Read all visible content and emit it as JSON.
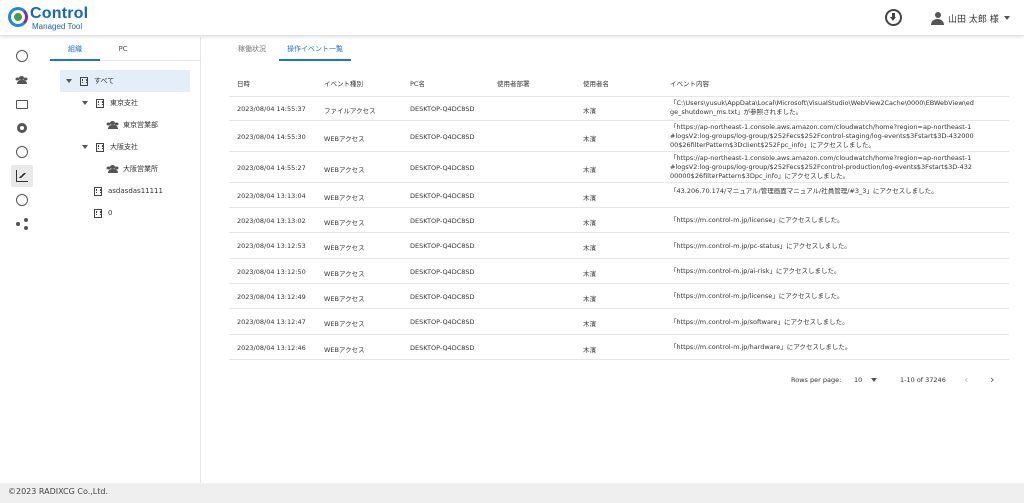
{
  "header": {
    "logo_title": "Control",
    "logo_subtitle": "Managed Tool",
    "user_name": "山田 太郎 様"
  },
  "rail": {
    "icons": [
      "gauge-icon",
      "users-icon",
      "monitor-icon",
      "target-icon",
      "badge-icon",
      "chart-icon",
      "download-circle-icon",
      "share-icon"
    ],
    "active": "chart-icon"
  },
  "org_panel": {
    "tabs": [
      "組織",
      "PC"
    ],
    "active_tab": "組織",
    "tree": [
      {
        "label": "すべて",
        "type": "building",
        "expanded": true,
        "selected": true
      },
      {
        "label": "東京支社",
        "type": "building",
        "expanded": true
      },
      {
        "label": "東京営業部",
        "type": "group"
      },
      {
        "label": "大阪支社",
        "type": "building",
        "expanded": true
      },
      {
        "label": "大阪営業所",
        "type": "group"
      },
      {
        "label": "asdasdas11111",
        "type": "building"
      },
      {
        "label": "0",
        "type": "building"
      }
    ]
  },
  "main": {
    "tabs": [
      "稼働状況",
      "操作イベント一覧"
    ],
    "active_tab": "操作イベント一覧",
    "columns": [
      "日時",
      "イベント種別",
      "PC名",
      "使用者部署",
      "使用者名",
      "イベント内容"
    ],
    "rows": [
      {
        "datetime": "2023/08/04 14:55:37",
        "type": "ファイルアクセス",
        "pc": "DESKTOP-Q4DC8SD",
        "dept": "",
        "user": "木濱",
        "content": "「C:\\Users\\yusuk\\AppData\\Local\\Microsoft\\VisualStudio\\WebView2Cache\\0000\\EBWebView\\edge_shutdown_ms.txt」が参照されました。"
      },
      {
        "datetime": "2023/08/04 14:55:30",
        "type": "WEBアクセス",
        "pc": "DESKTOP-Q4DC8SD",
        "dept": "",
        "user": "木濱",
        "content": "「https://ap-northeast-1.console.aws.amazon.com/cloudwatch/home?region=ap-northeast-1#logsV2:log-groups/log-group/$252Fecs$252Fcontrol-staging/log-events$3Fstart$3D-43200000$26filterPattern$3Dclient$252Fpc_info」にアクセスしました。"
      },
      {
        "datetime": "2023/08/04 14:55:27",
        "type": "WEBアクセス",
        "pc": "DESKTOP-Q4DC8SD",
        "dept": "",
        "user": "木濱",
        "content": "「https://ap-northeast-1.console.aws.amazon.com/cloudwatch/home?region=ap-northeast-1#logsV2:log-groups/log-group/$252Fecs$252Fcontrol-production/log-events$3Fstart$3D-43200000$26filterPattern$3Dpc_info」にアクセスしました。"
      },
      {
        "datetime": "2023/08/04 13:13:04",
        "type": "WEBアクセス",
        "pc": "DESKTOP-Q4DC8SD",
        "dept": "",
        "user": "木濱",
        "content": "「43.206.70.174/マニュアル/管理画面マニュアル/社員管理/#3_3」にアクセスしました。"
      },
      {
        "datetime": "2023/08/04 13:13:02",
        "type": "WEBアクセス",
        "pc": "DESKTOP-Q4DC8SD",
        "dept": "",
        "user": "木濱",
        "content": "「https://m.control-m.jp/license」にアクセスしました。"
      },
      {
        "datetime": "2023/08/04 13:12:53",
        "type": "WEBアクセス",
        "pc": "DESKTOP-Q4DC8SD",
        "dept": "",
        "user": "木濱",
        "content": "「https://m.control-m.jp/pc-status」にアクセスしました。"
      },
      {
        "datetime": "2023/08/04 13:12:50",
        "type": "WEBアクセス",
        "pc": "DESKTOP-Q4DC8SD",
        "dept": "",
        "user": "木濱",
        "content": "「https://m.control-m.jp/ai-risk」にアクセスしました。"
      },
      {
        "datetime": "2023/08/04 13:12:49",
        "type": "WEBアクセス",
        "pc": "DESKTOP-Q4DC8SD",
        "dept": "",
        "user": "木濱",
        "content": "「https://m.control-m.jp/license」にアクセスしました。"
      },
      {
        "datetime": "2023/08/04 13:12:47",
        "type": "WEBアクセス",
        "pc": "DESKTOP-Q4DC8SD",
        "dept": "",
        "user": "木濱",
        "content": "「https://m.control-m.jp/software」にアクセスしました。"
      },
      {
        "datetime": "2023/08/04 13:12:46",
        "type": "WEBアクセス",
        "pc": "DESKTOP-Q4DC8SD",
        "dept": "",
        "user": "木濱",
        "content": "「https://m.control-m.jp/hardware」にアクセスしました。"
      }
    ],
    "pagination": {
      "rows_per_page_label": "Rows per page:",
      "rows_per_page": "10",
      "range_text": "1-10 of 37246",
      "prev_glyph": "‹",
      "next_glyph": "›"
    }
  },
  "footer": {
    "copyright": "©2023 RADIXCG Co.,Ltd."
  },
  "colors": {
    "accent": "#1976d2",
    "selected_bg": "#e3eef9",
    "footer_bg": "#efefef"
  }
}
